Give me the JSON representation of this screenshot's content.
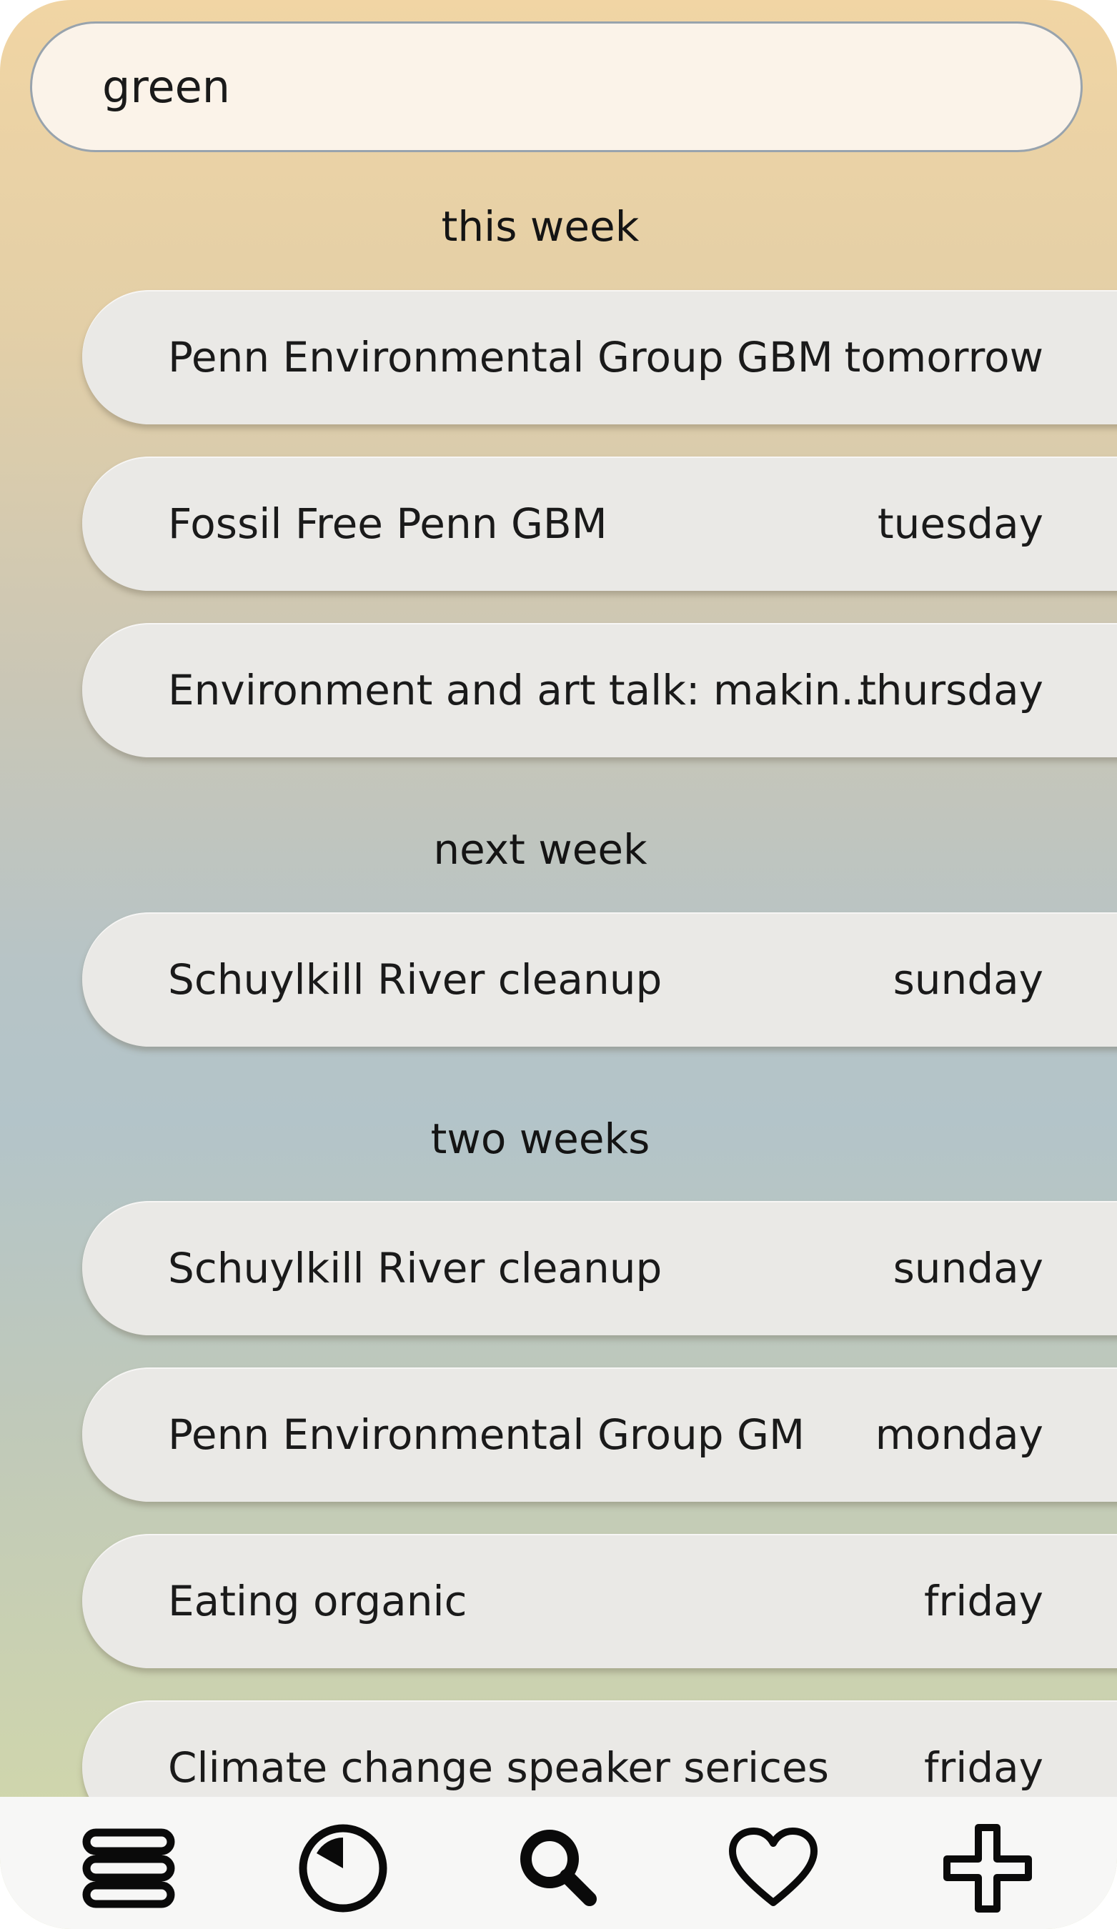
{
  "search": {
    "value": "green"
  },
  "sections": [
    {
      "heading": "this week",
      "events": [
        {
          "title": "Penn Environmental Group GBM",
          "day": "tomorrow"
        },
        {
          "title": "Fossil Free Penn GBM",
          "day": "tuesday"
        },
        {
          "title": "Environment and art talk: makin...",
          "day": "thursday"
        }
      ]
    },
    {
      "heading": "next week",
      "events": [
        {
          "title": "Schuylkill River cleanup",
          "day": "sunday"
        }
      ]
    },
    {
      "heading": "two weeks",
      "events": [
        {
          "title": "Schuylkill River cleanup",
          "day": "sunday"
        },
        {
          "title": "Penn Environmental Group GM",
          "day": "monday"
        },
        {
          "title": "Eating organic",
          "day": "friday"
        },
        {
          "title": "Climate change speaker serices",
          "day": "friday"
        }
      ]
    }
  ],
  "nav": [
    {
      "icon": "menu-icon"
    },
    {
      "icon": "clock-icon"
    },
    {
      "icon": "search-icon"
    },
    {
      "icon": "heart-icon"
    },
    {
      "icon": "plus-icon"
    }
  ]
}
